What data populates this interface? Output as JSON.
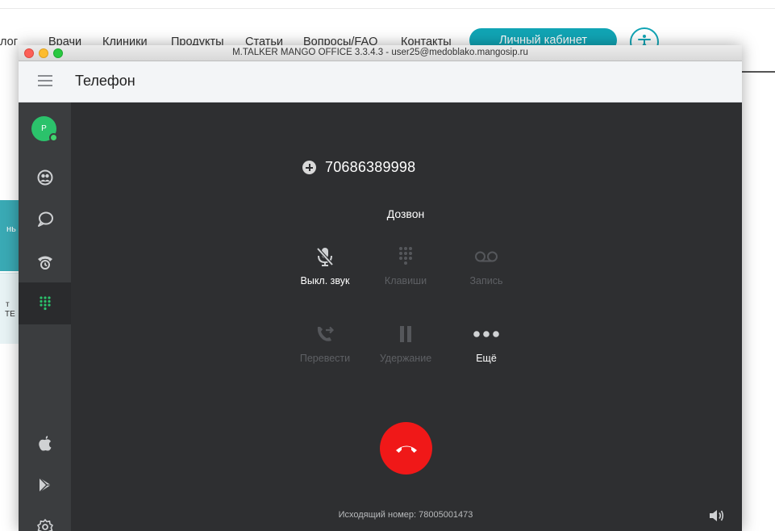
{
  "site": {
    "nav": [
      "лог",
      "Врачи",
      "Клиники",
      "Продукты",
      "Статьи",
      "Вопросы/FAQ",
      "Контакты"
    ],
    "cabinet_label": "Личный кабинет",
    "side_text_1": "нь",
    "side_text_2a": "т",
    "side_text_2b": "ТЕ"
  },
  "window": {
    "title": "M.TALKER MANGO OFFICE 3.3.4.3 - user25@medoblako.mangosip.ru"
  },
  "appbar": {
    "title": "Телефон"
  },
  "sidebar": {
    "avatar_letter": "P",
    "items": [
      {
        "icon": "contacts-icon"
      },
      {
        "icon": "chat-icon"
      },
      {
        "icon": "call-history-icon"
      },
      {
        "icon": "dialpad-icon",
        "active": true
      },
      {
        "icon": "apple-icon"
      },
      {
        "icon": "google-play-icon"
      },
      {
        "icon": "settings-icon"
      }
    ]
  },
  "call": {
    "number": "70686389998",
    "status": "Дозвон",
    "controls": {
      "mute": "Выкл. звук",
      "keypad": "Клавиши",
      "record": "Запись",
      "transfer": "Перевести",
      "hold": "Удержание",
      "more": "Ещё"
    },
    "outgoing_label": "Исходящий номер: 78005001473"
  },
  "colors": {
    "accent_green": "#2bc26b",
    "hangup_red": "#f01818",
    "site_teal": "#11a5b5"
  }
}
